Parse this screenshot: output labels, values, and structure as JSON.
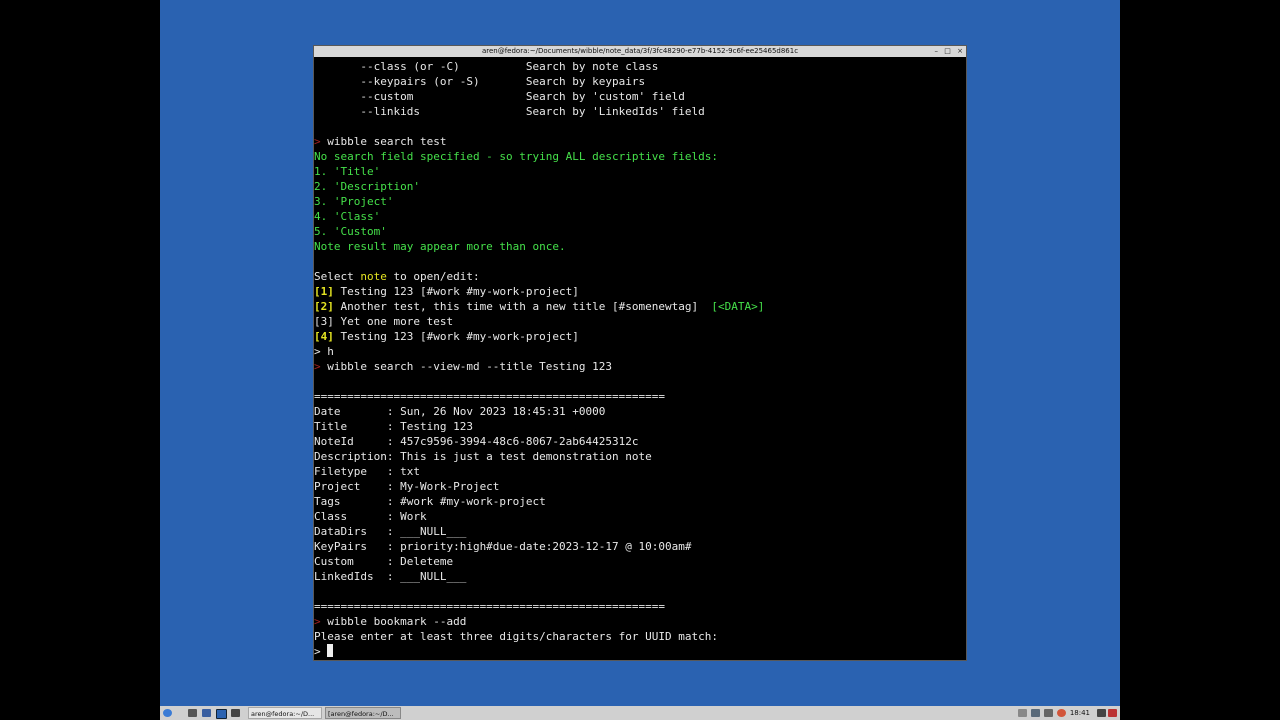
{
  "window": {
    "title": "aren@fedora:~/Documents/wibble/note_data/3f/3fc48290-e77b-4152-9c6f-ee25465d861c",
    "controls": [
      "–",
      "□",
      "×"
    ]
  },
  "terminal": {
    "lines": [
      [
        {
          "t": "       --class (or -C)          Search by note class",
          "c": ""
        }
      ],
      [
        {
          "t": "       --keypairs (or -S)       Search by keypairs",
          "c": ""
        }
      ],
      [
        {
          "t": "       --custom                 Search by 'custom' field",
          "c": ""
        }
      ],
      [
        {
          "t": "       --linkids                Search by 'LinkedIds' field",
          "c": ""
        }
      ],
      [],
      [
        {
          "t": ">",
          "c": "r"
        },
        {
          "t": " wibble search test",
          "c": ""
        }
      ],
      [
        {
          "t": "No search field specified - so trying ALL descriptive fields:",
          "c": "g"
        }
      ],
      [
        {
          "t": "1. 'Title'",
          "c": "g"
        }
      ],
      [
        {
          "t": "2. 'Description'",
          "c": "g"
        }
      ],
      [
        {
          "t": "3. 'Project'",
          "c": "g"
        }
      ],
      [
        {
          "t": "4. 'Class'",
          "c": "g"
        }
      ],
      [
        {
          "t": "5. 'Custom'",
          "c": "g"
        }
      ],
      [
        {
          "t": "Note result may appear more than once.",
          "c": "g"
        }
      ],
      [],
      [
        {
          "t": "Select ",
          "c": ""
        },
        {
          "t": "note",
          "c": "yn"
        },
        {
          "t": " to open/edit:",
          "c": ""
        }
      ],
      [
        {
          "t": "[1]",
          "c": "y"
        },
        {
          "t": " Testing 123 [#work #my-work-project]",
          "c": ""
        }
      ],
      [
        {
          "t": "[2]",
          "c": "y"
        },
        {
          "t": " Another test, this time with a new title [#somenewtag]  ",
          "c": ""
        },
        {
          "t": "[<DATA>]",
          "c": "g"
        }
      ],
      [
        {
          "t": "[3]",
          "c": ""
        },
        {
          "t": " Yet one more test",
          "c": ""
        }
      ],
      [
        {
          "t": "[4]",
          "c": "y"
        },
        {
          "t": " Testing 123 [#work #my-work-project]",
          "c": ""
        }
      ],
      [
        {
          "t": "> h",
          "c": ""
        }
      ],
      [
        {
          "t": ">",
          "c": "r"
        },
        {
          "t": " wibble search --view-md --title Testing 123",
          "c": ""
        }
      ],
      [],
      [
        {
          "t": "=====================================================",
          "c": ""
        }
      ],
      [
        {
          "t": "Date       : Sun, 26 Nov 2023 18:45:31 +0000",
          "c": ""
        }
      ],
      [
        {
          "t": "Title      : Testing 123",
          "c": ""
        }
      ],
      [
        {
          "t": "NoteId     : 457c9596-3994-48c6-8067-2ab64425312c",
          "c": ""
        }
      ],
      [
        {
          "t": "Description: This is just a test demonstration note",
          "c": ""
        }
      ],
      [
        {
          "t": "Filetype   : txt",
          "c": ""
        }
      ],
      [
        {
          "t": "Project    : My-Work-Project",
          "c": ""
        }
      ],
      [
        {
          "t": "Tags       : #work #my-work-project",
          "c": ""
        }
      ],
      [
        {
          "t": "Class      : Work",
          "c": ""
        }
      ],
      [
        {
          "t": "DataDirs   : ___NULL___",
          "c": ""
        }
      ],
      [
        {
          "t": "KeyPairs   : priority:high#due-date:2023-12-17 @ 10:00am#",
          "c": ""
        }
      ],
      [
        {
          "t": "Custom     : Deleteme",
          "c": ""
        }
      ],
      [
        {
          "t": "LinkedIds  : ___NULL___",
          "c": ""
        }
      ],
      [],
      [
        {
          "t": "=====================================================",
          "c": ""
        }
      ],
      [
        {
          "t": ">",
          "c": "r"
        },
        {
          "t": " wibble bookmark --add",
          "c": ""
        }
      ],
      [
        {
          "t": "Please enter at least three digits/characters for UUID match:",
          "c": ""
        }
      ],
      [
        {
          "t": "> ",
          "c": ""
        }
      ]
    ]
  },
  "taskbar": {
    "tasks": [
      "aren@fedora:~/D...",
      "[aren@fedora:~/D..."
    ],
    "clock": "18:41",
    "colors": {
      "bar": "#d0d0d0",
      "desktop": "#2a62b1"
    }
  }
}
